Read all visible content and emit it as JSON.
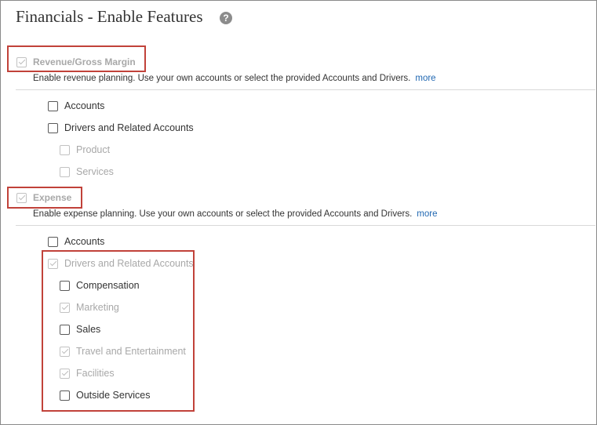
{
  "header": {
    "title": "Financials - Enable Features",
    "help_icon": "?"
  },
  "revenue": {
    "label": "Revenue/Gross Margin",
    "checked": true,
    "description": "Enable revenue planning. Use your own accounts or select the provided Accounts and Drivers.",
    "more": "more",
    "options": {
      "accounts": "Accounts",
      "drivers": "Drivers and Related Accounts",
      "product": "Product",
      "services": "Services"
    }
  },
  "expense": {
    "label": "Expense",
    "checked": true,
    "description": "Enable expense planning. Use your own accounts or select the provided Accounts and Drivers.",
    "more": "more",
    "options": {
      "accounts": "Accounts",
      "drivers": "Drivers and Related Accounts",
      "compensation": "Compensation",
      "marketing": "Marketing",
      "sales": "Sales",
      "travel": "Travel and Entertainment",
      "facilities": "Facilities",
      "outside_services": "Outside Services"
    }
  },
  "colors": {
    "callout": "#c1423a",
    "link": "#2168b2",
    "disabled_text": "#a8a8a8"
  }
}
